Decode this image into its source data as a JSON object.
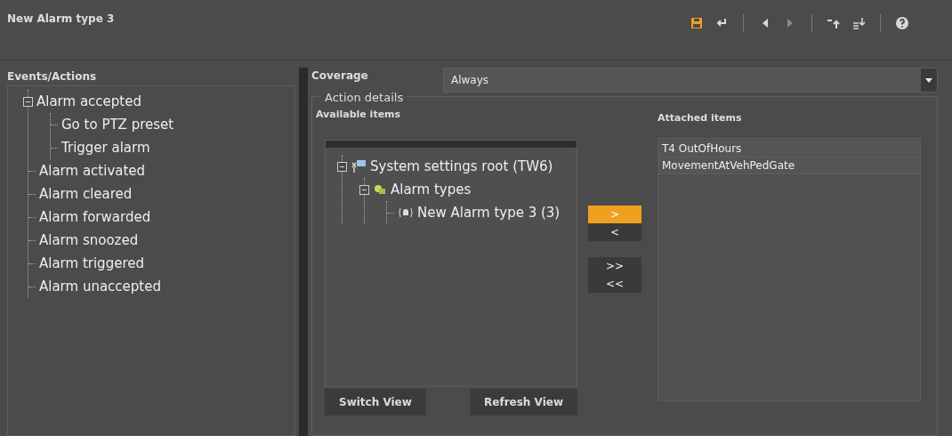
{
  "window": {
    "title": "New Alarm type 3"
  },
  "toolbar": [
    {
      "kind": "save",
      "active": true
    },
    {
      "kind": "undo",
      "active": false
    },
    {
      "kind": "sep"
    },
    {
      "kind": "prev",
      "active": false
    },
    {
      "kind": "next",
      "active": false
    },
    {
      "kind": "sep"
    },
    {
      "kind": "moveup",
      "active": false
    },
    {
      "kind": "movedown",
      "active": false
    },
    {
      "kind": "sep"
    },
    {
      "kind": "help",
      "active": false
    }
  ],
  "events_panel": {
    "title": "Events/Actions",
    "tree": [
      {
        "label": "Alarm accepted",
        "expanded": true,
        "children": [
          {
            "label": "Go to PTZ preset"
          },
          {
            "label": "Trigger alarm"
          }
        ]
      },
      {
        "label": "Alarm activated"
      },
      {
        "label": "Alarm cleared"
      },
      {
        "label": "Alarm forwarded"
      },
      {
        "label": "Alarm snoozed"
      },
      {
        "label": "Alarm triggered"
      },
      {
        "label": "Alarm unaccepted"
      }
    ]
  },
  "coverage": {
    "label": "Coverage",
    "value": "Always"
  },
  "action_details": {
    "title": "Action details",
    "available": {
      "title": "Available items",
      "tree": [
        {
          "label": "System settings root (TW6)",
          "kind": "root",
          "expanded": true,
          "children": [
            {
              "label": "Alarm types",
              "kind": "folder",
              "expanded": true,
              "children": [
                {
                  "label": "New Alarm type 3 (3)",
                  "kind": "bell"
                }
              ]
            }
          ]
        }
      ],
      "buttons": [
        "Switch View",
        "Refresh View"
      ]
    },
    "transfer_buttons": [
      {
        "label": ">",
        "active": true
      },
      {
        "label": "<",
        "active": false
      },
      {
        "label": ">>",
        "active": false
      },
      {
        "label": "<<",
        "active": false
      }
    ],
    "attached": {
      "title": "Attached items",
      "items": [
        "T4 OutOfHours",
        "MovementAtVehPedGate"
      ]
    }
  }
}
